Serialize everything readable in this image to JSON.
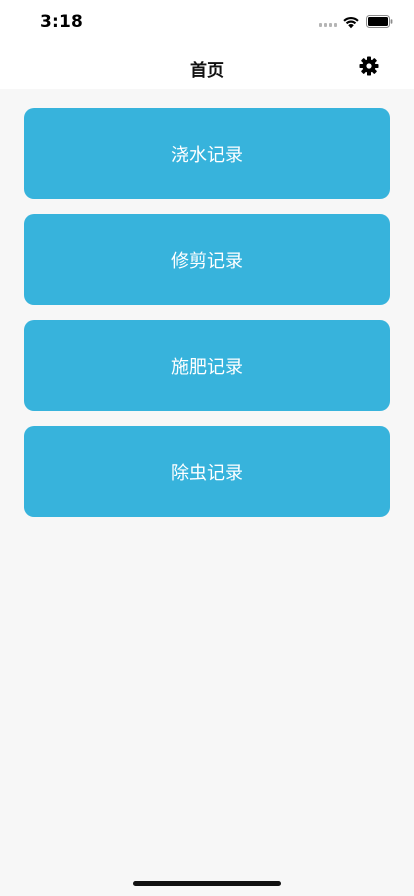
{
  "status_bar": {
    "time": "3:18"
  },
  "nav": {
    "title": "首页",
    "settings_icon": "gear-icon"
  },
  "records": [
    {
      "id": "watering",
      "label": "浇水记录"
    },
    {
      "id": "pruning",
      "label": "修剪记录"
    },
    {
      "id": "fertilizing",
      "label": "施肥记录"
    },
    {
      "id": "pest-control",
      "label": "除虫记录"
    }
  ],
  "colors": {
    "accent": "#37b3dc",
    "background": "#f7f7f7",
    "header": "#ffffff"
  }
}
